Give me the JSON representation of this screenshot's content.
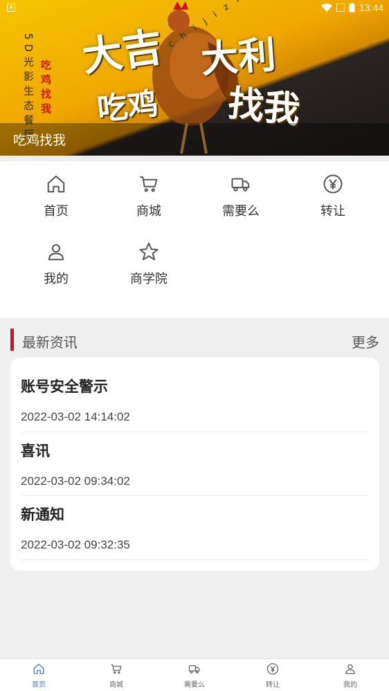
{
  "status_bar": {
    "time": "13:44"
  },
  "banner": {
    "vertical_text": "5D光影生态餐厅",
    "vertical_red_text": "吃鸡找我",
    "calligraphy": [
      "大吉",
      "大利",
      "吃鸡",
      "找我"
    ],
    "latin_text": "chijizhaowo",
    "caption": "吃鸡找我"
  },
  "menu": {
    "items": [
      {
        "label": "首页",
        "icon": "home-icon"
      },
      {
        "label": "商城",
        "icon": "cart-icon"
      },
      {
        "label": "需要么",
        "icon": "truck-icon"
      },
      {
        "label": "转让",
        "icon": "yen-icon"
      },
      {
        "label": "我的",
        "icon": "user-icon"
      },
      {
        "label": "商学院",
        "icon": "star-icon"
      }
    ]
  },
  "news": {
    "title": "最新资讯",
    "more": "更多",
    "items": [
      {
        "title": "账号安全警示",
        "date": "2022-03-02 14:14:02"
      },
      {
        "title": "喜讯",
        "date": "2022-03-02 09:34:02"
      },
      {
        "title": "新通知",
        "date": "2022-03-02 09:32:35"
      }
    ]
  },
  "tabbar": {
    "items": [
      {
        "label": "首页",
        "icon": "home-icon",
        "active": true
      },
      {
        "label": "商城",
        "icon": "cart-icon"
      },
      {
        "label": "需要么",
        "icon": "truck-icon"
      },
      {
        "label": "转让",
        "icon": "yen-icon"
      },
      {
        "label": "我的",
        "icon": "user-icon"
      }
    ],
    "active_color": "#3a7bd5"
  },
  "colors": {
    "accent_red": "#d0121a",
    "banner_yellow": "#f6c400"
  }
}
